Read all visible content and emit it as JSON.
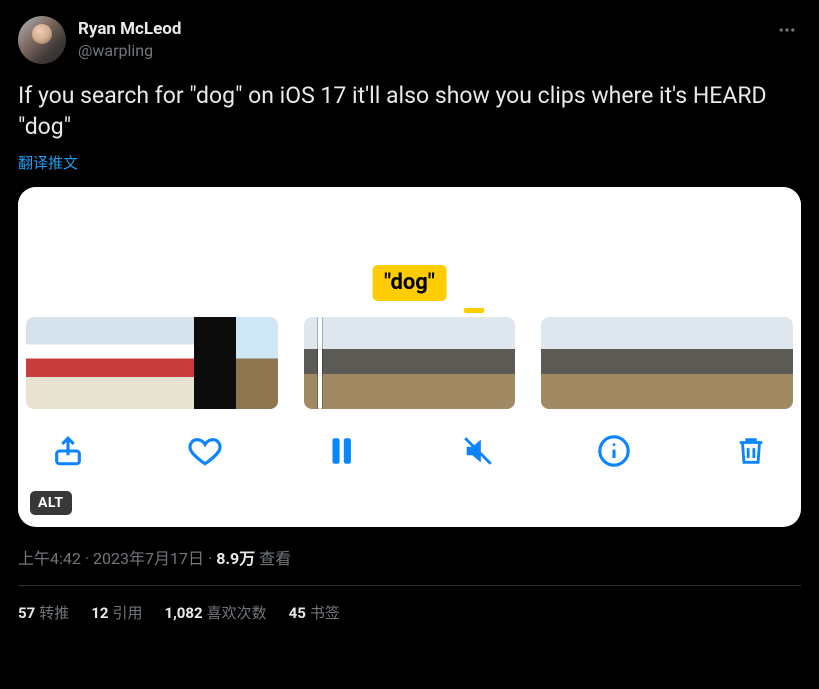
{
  "author": {
    "display_name": "Ryan McLeod",
    "handle": "@warpling"
  },
  "tweet": {
    "text": "If you search for \"dog\" on iOS 17 it'll also show you clips where it's HEARD \"dog\"",
    "translate_label": "翻译推文"
  },
  "media": {
    "keyword_pill": "\"dog\"",
    "alt_badge": "ALT"
  },
  "meta": {
    "time": "上午4:42",
    "date": "2023年7月17日",
    "views_number": "8.9万",
    "views_label": "查看"
  },
  "stats": {
    "retweets_num": "57",
    "retweets_label": "转推",
    "quotes_num": "12",
    "quotes_label": "引用",
    "likes_num": "1,082",
    "likes_label": "喜欢次数",
    "bookmarks_num": "45",
    "bookmarks_label": "书签"
  }
}
